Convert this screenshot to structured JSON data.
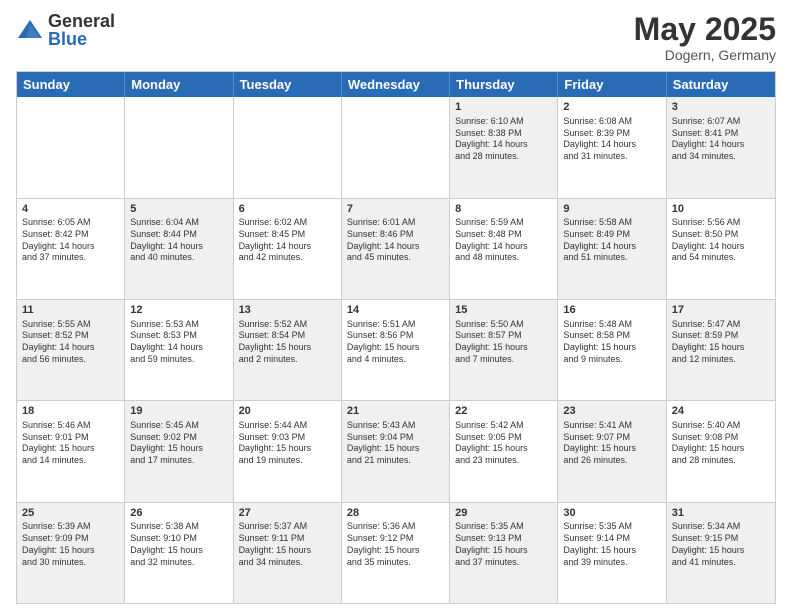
{
  "header": {
    "logo_general": "General",
    "logo_blue": "Blue",
    "title": "May 2025",
    "location": "Dogern, Germany"
  },
  "days_of_week": [
    "Sunday",
    "Monday",
    "Tuesday",
    "Wednesday",
    "Thursday",
    "Friday",
    "Saturday"
  ],
  "weeks": [
    [
      {
        "day": "",
        "info": "",
        "shaded": false
      },
      {
        "day": "",
        "info": "",
        "shaded": false
      },
      {
        "day": "",
        "info": "",
        "shaded": false
      },
      {
        "day": "",
        "info": "",
        "shaded": false
      },
      {
        "day": "1",
        "info": "Sunrise: 6:10 AM\nSunset: 8:38 PM\nDaylight: 14 hours\nand 28 minutes.",
        "shaded": true
      },
      {
        "day": "2",
        "info": "Sunrise: 6:08 AM\nSunset: 8:39 PM\nDaylight: 14 hours\nand 31 minutes.",
        "shaded": false
      },
      {
        "day": "3",
        "info": "Sunrise: 6:07 AM\nSunset: 8:41 PM\nDaylight: 14 hours\nand 34 minutes.",
        "shaded": true
      }
    ],
    [
      {
        "day": "4",
        "info": "Sunrise: 6:05 AM\nSunset: 8:42 PM\nDaylight: 14 hours\nand 37 minutes.",
        "shaded": false
      },
      {
        "day": "5",
        "info": "Sunrise: 6:04 AM\nSunset: 8:44 PM\nDaylight: 14 hours\nand 40 minutes.",
        "shaded": true
      },
      {
        "day": "6",
        "info": "Sunrise: 6:02 AM\nSunset: 8:45 PM\nDaylight: 14 hours\nand 42 minutes.",
        "shaded": false
      },
      {
        "day": "7",
        "info": "Sunrise: 6:01 AM\nSunset: 8:46 PM\nDaylight: 14 hours\nand 45 minutes.",
        "shaded": true
      },
      {
        "day": "8",
        "info": "Sunrise: 5:59 AM\nSunset: 8:48 PM\nDaylight: 14 hours\nand 48 minutes.",
        "shaded": false
      },
      {
        "day": "9",
        "info": "Sunrise: 5:58 AM\nSunset: 8:49 PM\nDaylight: 14 hours\nand 51 minutes.",
        "shaded": true
      },
      {
        "day": "10",
        "info": "Sunrise: 5:56 AM\nSunset: 8:50 PM\nDaylight: 14 hours\nand 54 minutes.",
        "shaded": false
      }
    ],
    [
      {
        "day": "11",
        "info": "Sunrise: 5:55 AM\nSunset: 8:52 PM\nDaylight: 14 hours\nand 56 minutes.",
        "shaded": true
      },
      {
        "day": "12",
        "info": "Sunrise: 5:53 AM\nSunset: 8:53 PM\nDaylight: 14 hours\nand 59 minutes.",
        "shaded": false
      },
      {
        "day": "13",
        "info": "Sunrise: 5:52 AM\nSunset: 8:54 PM\nDaylight: 15 hours\nand 2 minutes.",
        "shaded": true
      },
      {
        "day": "14",
        "info": "Sunrise: 5:51 AM\nSunset: 8:56 PM\nDaylight: 15 hours\nand 4 minutes.",
        "shaded": false
      },
      {
        "day": "15",
        "info": "Sunrise: 5:50 AM\nSunset: 8:57 PM\nDaylight: 15 hours\nand 7 minutes.",
        "shaded": true
      },
      {
        "day": "16",
        "info": "Sunrise: 5:48 AM\nSunset: 8:58 PM\nDaylight: 15 hours\nand 9 minutes.",
        "shaded": false
      },
      {
        "day": "17",
        "info": "Sunrise: 5:47 AM\nSunset: 8:59 PM\nDaylight: 15 hours\nand 12 minutes.",
        "shaded": true
      }
    ],
    [
      {
        "day": "18",
        "info": "Sunrise: 5:46 AM\nSunset: 9:01 PM\nDaylight: 15 hours\nand 14 minutes.",
        "shaded": false
      },
      {
        "day": "19",
        "info": "Sunrise: 5:45 AM\nSunset: 9:02 PM\nDaylight: 15 hours\nand 17 minutes.",
        "shaded": true
      },
      {
        "day": "20",
        "info": "Sunrise: 5:44 AM\nSunset: 9:03 PM\nDaylight: 15 hours\nand 19 minutes.",
        "shaded": false
      },
      {
        "day": "21",
        "info": "Sunrise: 5:43 AM\nSunset: 9:04 PM\nDaylight: 15 hours\nand 21 minutes.",
        "shaded": true
      },
      {
        "day": "22",
        "info": "Sunrise: 5:42 AM\nSunset: 9:05 PM\nDaylight: 15 hours\nand 23 minutes.",
        "shaded": false
      },
      {
        "day": "23",
        "info": "Sunrise: 5:41 AM\nSunset: 9:07 PM\nDaylight: 15 hours\nand 26 minutes.",
        "shaded": true
      },
      {
        "day": "24",
        "info": "Sunrise: 5:40 AM\nSunset: 9:08 PM\nDaylight: 15 hours\nand 28 minutes.",
        "shaded": false
      }
    ],
    [
      {
        "day": "25",
        "info": "Sunrise: 5:39 AM\nSunset: 9:09 PM\nDaylight: 15 hours\nand 30 minutes.",
        "shaded": true
      },
      {
        "day": "26",
        "info": "Sunrise: 5:38 AM\nSunset: 9:10 PM\nDaylight: 15 hours\nand 32 minutes.",
        "shaded": false
      },
      {
        "day": "27",
        "info": "Sunrise: 5:37 AM\nSunset: 9:11 PM\nDaylight: 15 hours\nand 34 minutes.",
        "shaded": true
      },
      {
        "day": "28",
        "info": "Sunrise: 5:36 AM\nSunset: 9:12 PM\nDaylight: 15 hours\nand 35 minutes.",
        "shaded": false
      },
      {
        "day": "29",
        "info": "Sunrise: 5:35 AM\nSunset: 9:13 PM\nDaylight: 15 hours\nand 37 minutes.",
        "shaded": true
      },
      {
        "day": "30",
        "info": "Sunrise: 5:35 AM\nSunset: 9:14 PM\nDaylight: 15 hours\nand 39 minutes.",
        "shaded": false
      },
      {
        "day": "31",
        "info": "Sunrise: 5:34 AM\nSunset: 9:15 PM\nDaylight: 15 hours\nand 41 minutes.",
        "shaded": true
      }
    ]
  ]
}
